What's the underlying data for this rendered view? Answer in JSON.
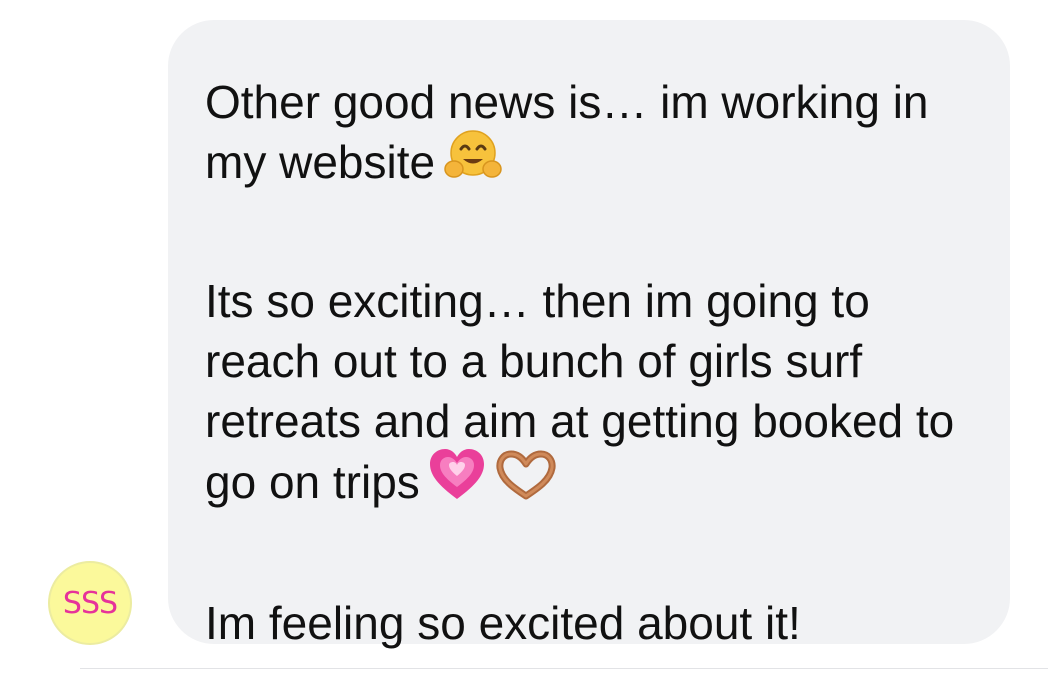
{
  "message": {
    "paragraphs": [
      {
        "text": "Other good news is… im working in my website",
        "emojis": [
          "hugging-face"
        ]
      },
      {
        "text": "Its so exciting… then im going to reach out to a bunch of girls surf retreats and aim at getting booked to go on trips",
        "emojis": [
          "growing-heart",
          "heart-hands"
        ]
      },
      {
        "text": "Im feeling so excited about it!",
        "emojis": []
      }
    ]
  },
  "avatar": {
    "initials": "SSS",
    "background": "#fbf99b",
    "text_color": "#e6339a"
  },
  "colors": {
    "bubble": "#f1f2f4",
    "text": "#111111"
  }
}
